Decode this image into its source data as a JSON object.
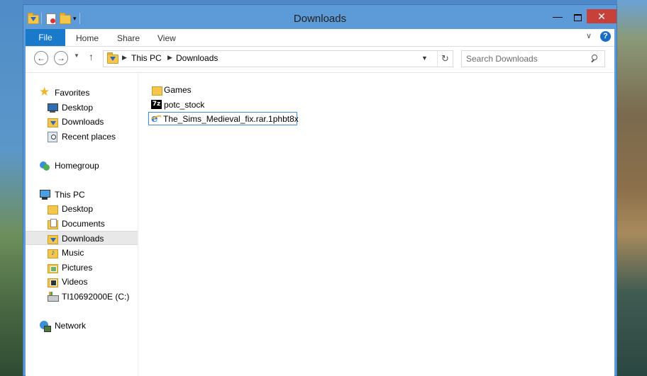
{
  "window": {
    "title": "Downloads",
    "minimize_glyph": "—",
    "close_glyph": "✕"
  },
  "ribbon": {
    "tabs": [
      "File",
      "Home",
      "Share",
      "View"
    ],
    "help_glyph": "?"
  },
  "navigation": {
    "back_glyph": "←",
    "forward_glyph": "→",
    "up_glyph": "↑",
    "breadcrumb": [
      "This PC",
      "Downloads"
    ],
    "search_placeholder": "Search Downloads"
  },
  "sidebar": {
    "favorites": {
      "label": "Favorites",
      "items": [
        "Desktop",
        "Downloads",
        "Recent places"
      ]
    },
    "homegroup": "Homegroup",
    "this_pc": {
      "label": "This PC",
      "items": [
        "Desktop",
        "Documents",
        "Downloads",
        "Music",
        "Pictures",
        "Videos",
        "TI10692000E (C:)"
      ],
      "selected": "Downloads"
    },
    "network": "Network"
  },
  "files": [
    {
      "name": "Games",
      "icon": "folder-icon"
    },
    {
      "name": "potc_stock",
      "icon": "7z-archive-icon"
    },
    {
      "name": "The_Sims_Medieval_fix.rar.1phbt8x",
      "icon": "ie-file-icon",
      "renaming": true
    }
  ],
  "colors": {
    "file_tab": "#1979ca",
    "close_button": "#c7413a",
    "window_frame": "#5d9ad8",
    "selection_border": "#3d8ee0"
  }
}
